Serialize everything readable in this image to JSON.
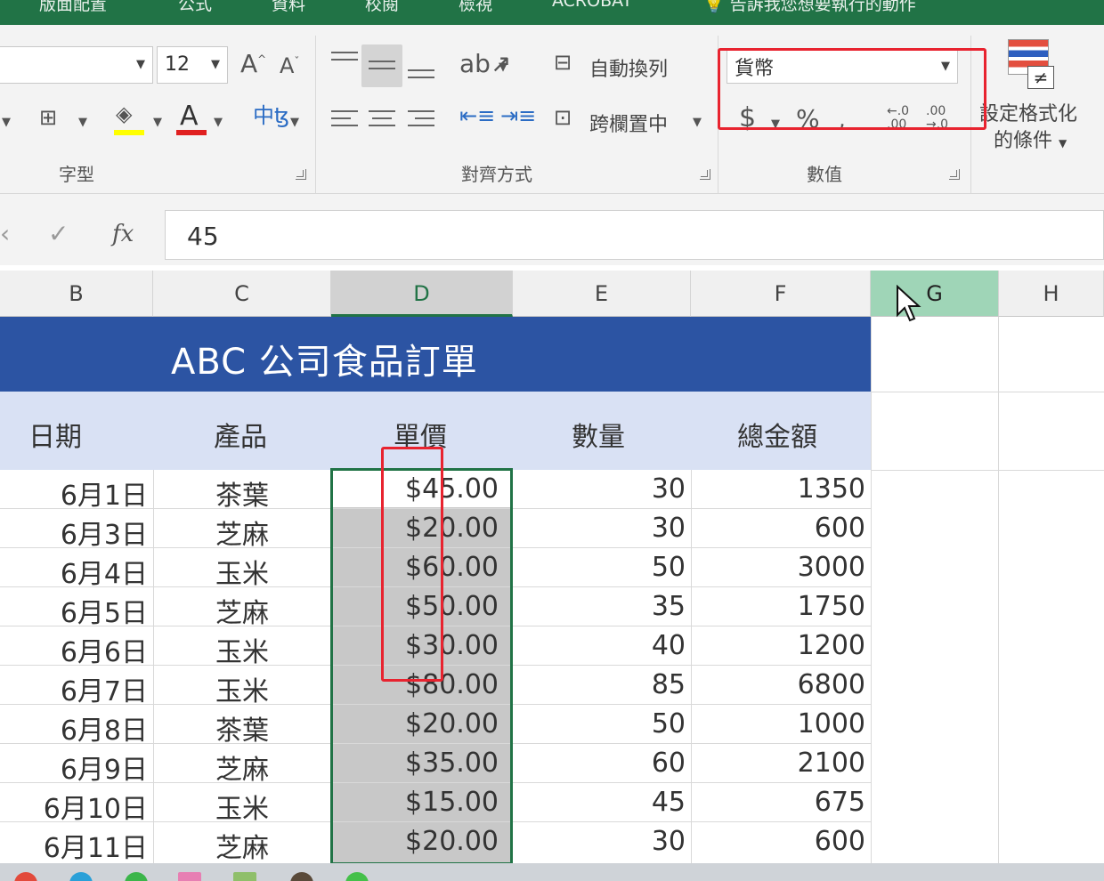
{
  "tabs": [
    "版面配置",
    "公式",
    "資料",
    "校閱",
    "檢視",
    "ACROBAT",
    "告訴我您想要執行的動作"
  ],
  "font_group": {
    "label": "字型",
    "font_size": "12",
    "grow_icon": "Aˆ",
    "shrink_icon": "Aˇ",
    "phonetic_label": "中"
  },
  "alignment_group": {
    "label": "對齊方式",
    "wrap_text": "自動換列",
    "merge_center": "跨欄置中"
  },
  "number_group": {
    "label": "數值",
    "format": "貨幣",
    "currency_symbol": "$",
    "percent_symbol": "%",
    "increase_decimal": "←.0\n.00",
    "decrease_decimal": ".00\n→.0"
  },
  "styles_group": {
    "conditional_formatting_line1": "設定格式化",
    "conditional_formatting_line2": "的條件"
  },
  "formula_bar": {
    "fx": "fx",
    "value": "45"
  },
  "columns": [
    "B",
    "C",
    "D",
    "E",
    "F",
    "G",
    "H"
  ],
  "sheet": {
    "title": "ABC 公司食品訂單",
    "headers": {
      "date": "日期",
      "product": "產品",
      "price": "單價",
      "qty": "數量",
      "total": "總金額"
    },
    "rows": [
      {
        "date": "6月1日",
        "product": "茶葉",
        "price": "$45.00",
        "qty": "30",
        "total": "1350"
      },
      {
        "date": "6月3日",
        "product": "芝麻",
        "price": "$20.00",
        "qty": "30",
        "total": "600"
      },
      {
        "date": "6月4日",
        "product": "玉米",
        "price": "$60.00",
        "qty": "50",
        "total": "3000"
      },
      {
        "date": "6月5日",
        "product": "芝麻",
        "price": "$50.00",
        "qty": "35",
        "total": "1750"
      },
      {
        "date": "6月6日",
        "product": "玉米",
        "price": "$30.00",
        "qty": "40",
        "total": "1200"
      },
      {
        "date": "6月7日",
        "product": "玉米",
        "price": "$80.00",
        "qty": "85",
        "total": "6800"
      },
      {
        "date": "6月8日",
        "product": "茶葉",
        "price": "$20.00",
        "qty": "50",
        "total": "1000"
      },
      {
        "date": "6月9日",
        "product": "芝麻",
        "price": "$35.00",
        "qty": "60",
        "total": "2100"
      },
      {
        "date": "6月10日",
        "product": "玉米",
        "price": "$15.00",
        "qty": "45",
        "total": "675"
      },
      {
        "date": "6月11日",
        "product": "芝麻",
        "price": "$20.00",
        "qty": "30",
        "total": "600"
      }
    ]
  },
  "colors": {
    "excel_green": "#217346",
    "title_band": "#2c54a3",
    "header_band": "#d9e1f4",
    "annotation_red": "#e8232f"
  }
}
